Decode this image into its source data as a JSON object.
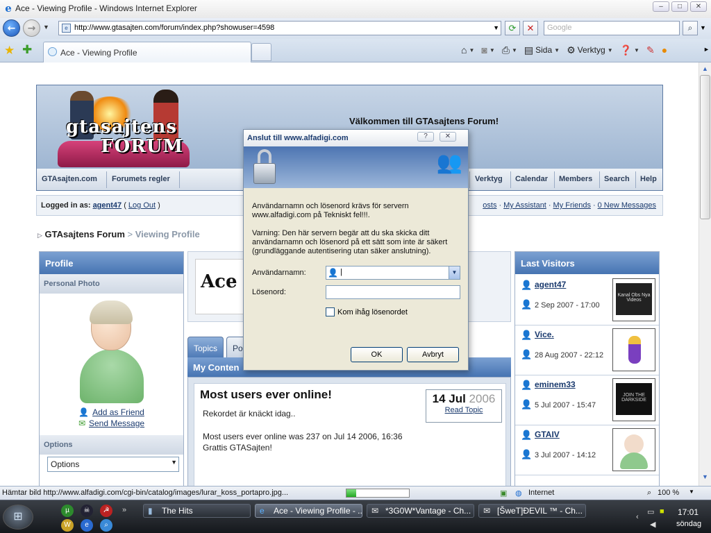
{
  "browser": {
    "window_title": "Ace - Viewing Profile - Windows Internet Explorer",
    "url": "http://www.gtasajten.com/forum/index.php?showuser=4598",
    "search_placeholder": "Google",
    "tab_label": "Ace - Viewing Profile",
    "commands": {
      "page": "Sida",
      "tools": "Verktyg"
    },
    "status_text": "Hämtar bild http://www.alfadigi.com/cgi-bin/catalog/images/lurar_koss_portapro.jpg...",
    "progress": 0.15,
    "zone": "Internet",
    "zoom": "100 %"
  },
  "forum": {
    "welcome": "Välkommen till GTAsajtens Forum!",
    "logo_text_1": "gtasajtens",
    "logo_text_2": "FORUM",
    "nav": [
      "GTAsajten.com",
      "Forumets regler",
      "Verktyg",
      "Calendar",
      "Members",
      "Search",
      "Help"
    ],
    "userbar": {
      "logged_prefix": "Logged in as:",
      "username": "agent47",
      "logout": "Log Out",
      "links": [
        "osts",
        "My Assistant",
        "My Friends",
        "0 New Messages"
      ]
    },
    "breadcrumb": {
      "root": "GTAsajtens Forum",
      "sep": ">",
      "current": "Viewing Profile"
    },
    "profile": {
      "head": "Profile",
      "photo_head": "Personal Photo",
      "add_friend": "Add as Friend",
      "send_message": "Send Message",
      "options_head": "Options",
      "options_value": "Options"
    },
    "member_name": "Ace",
    "tabs": [
      "Topics",
      "Pos"
    ],
    "content_head": "My Conten",
    "post": {
      "title": "Most users ever online!",
      "line1": "Rekordet är knäckt idag..",
      "line2": "Most users ever online was 237 on Jul 14 2006, 16:36",
      "line3": "Grattis GTASajten!",
      "date_daymonth": "14 Jul",
      "date_year": "2006",
      "read_topic": "Read Topic"
    },
    "last_visitors_head": "Last Visitors",
    "visitors": [
      {
        "name": "agent47",
        "date": "2 Sep 2007 - 17:00",
        "thumb": "Kanal Obs Nya Videos"
      },
      {
        "name": "Vice.",
        "date": "28 Aug 2007 - 22:12",
        "thumb": ""
      },
      {
        "name": "eminem33",
        "date": "5 Jul 2007 - 15:47",
        "thumb": "JOIN THE DARKSIDE"
      },
      {
        "name": "GTAIV",
        "date": "3 Jul 2007 - 14:12",
        "thumb": ""
      }
    ]
  },
  "dialog": {
    "title": "Anslut till www.alfadigi.com",
    "text1_line1": "Användarnamn och lösenord krävs för servern",
    "text1_line2": "www.alfadigi.com på Tekniskt fel!!!.",
    "text2_line1": "Varning: Den här servern begär att du ska skicka ditt",
    "text2_line2": "användarnamn och lösenord på ett sätt som inte är säkert",
    "text2_line3": "(grundläggande autentisering utan säker anslutning).",
    "username_label": "Användarnamn:",
    "password_label": "Lösenord:",
    "remember": "Kom ihåg lösenordet",
    "ok": "OK",
    "cancel": "Avbryt"
  },
  "taskbar": {
    "buttons": [
      "The Hits",
      "Ace - Viewing Profile - ...",
      "*3G0W*Vantage - Ch...",
      "[ŠweT]ÐEVIL ™ - Ch..."
    ],
    "clock": "17:01",
    "day": "söndag"
  },
  "colors": {
    "accent": "#4674b2",
    "link": "#1a3a6e",
    "dialog_bg": "#ece9d8"
  }
}
